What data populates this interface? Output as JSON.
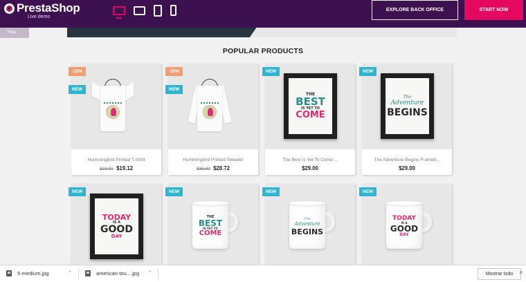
{
  "topbar": {
    "brand": "PrestaShop",
    "brand_sub": "Live demo",
    "explore_label": "EXPLORE BACK OFFICE",
    "start_label": "START NOW",
    "hide_label": "Hide",
    "devices": [
      "desktop-icon",
      "tablet-landscape-icon",
      "tablet-portrait-icon",
      "phone-icon"
    ]
  },
  "colors": {
    "topbar_bg": "#3d1150",
    "accent_pink": "#e4085f",
    "new_flag": "#2fb5d2",
    "discount_flag": "#f39d72"
  },
  "section": {
    "title": "POPULAR PRODUCTS"
  },
  "products": [
    {
      "flags": [
        "-20%",
        "NEW"
      ],
      "name": "Hummingbird Printed T-Shirt",
      "old_price": "$23.90",
      "price": "$19.12"
    },
    {
      "flags": [
        "-20%",
        "NEW"
      ],
      "name": "Hummingbird Printed Sweater",
      "old_price": "$35.90",
      "price": "$28.72"
    },
    {
      "flags": [
        "NEW"
      ],
      "name": "The Best Is Yet To Come'...",
      "price": "$29.00",
      "art": {
        "line1": "THE",
        "line2": "BEST",
        "line3": "IS YET TO",
        "line4": "COME"
      }
    },
    {
      "flags": [
        "NEW"
      ],
      "name": "The Adventure Begins Framed...",
      "price": "$29.00",
      "art": {
        "line1": "The",
        "line2": "Adventure",
        "line3": "BEGINS"
      }
    },
    {
      "flags": [
        "NEW"
      ],
      "art": {
        "line1": "TODAY",
        "line2": "IS A",
        "line3": "GOOD",
        "line4": "DAY"
      }
    },
    {
      "flags": [
        "NEW"
      ],
      "art": {
        "line1": "THE",
        "line2": "BEST",
        "line3": "IS YET TO",
        "line4": "COME"
      }
    },
    {
      "flags": [
        "NEW"
      ],
      "art": {
        "line1": "The",
        "line2": "Adventure",
        "line3": "BEGINS"
      }
    },
    {
      "flags": [
        "NEW"
      ],
      "art": {
        "line1": "TODAY",
        "line2": "IS A",
        "line3": "GOOD",
        "line4": "DAY"
      }
    }
  ],
  "downloads": {
    "items": [
      {
        "name": "5-medium.jpg"
      },
      {
        "name": "american-tou....jpg"
      }
    ],
    "show_all_label": "Mostrar todo"
  }
}
